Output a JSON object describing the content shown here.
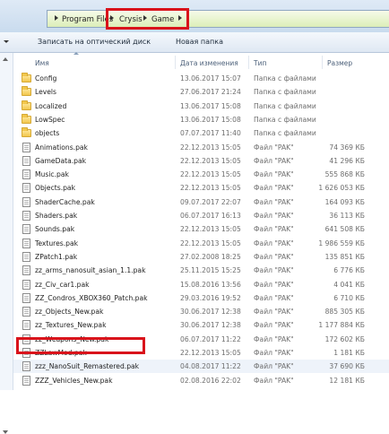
{
  "address": {
    "crumbs": [
      "Program Files",
      "Crysis",
      "Game"
    ]
  },
  "toolbar": {
    "burn_label": "Записать на оптический диск",
    "new_folder_label": "Новая папка"
  },
  "columns": {
    "name": "Имя",
    "date": "Дата изменения",
    "type": "Тип",
    "size": "Размер"
  },
  "files": [
    {
      "name": "Config",
      "date": "13.06.2017 15:07",
      "type": "Папка с файлами",
      "size": "",
      "icon": "folder-icon"
    },
    {
      "name": "Levels",
      "date": "27.06.2017 21:24",
      "type": "Папка с файлами",
      "size": "",
      "icon": "folder-icon"
    },
    {
      "name": "Localized",
      "date": "13.06.2017 15:08",
      "type": "Папка с файлами",
      "size": "",
      "icon": "folder-icon"
    },
    {
      "name": "LowSpec",
      "date": "13.06.2017 15:08",
      "type": "Папка с файлами",
      "size": "",
      "icon": "folder-icon"
    },
    {
      "name": "objects",
      "date": "07.07.2017 11:40",
      "type": "Папка с файлами",
      "size": "",
      "icon": "folder-icon"
    },
    {
      "name": "Animations.pak",
      "date": "22.12.2013 15:05",
      "type": "Файл \"PAK\"",
      "size": "74 369 КБ",
      "icon": "file-icon"
    },
    {
      "name": "GameData.pak",
      "date": "22.12.2013 15:05",
      "type": "Файл \"PAK\"",
      "size": "41 296 КБ",
      "icon": "file-icon"
    },
    {
      "name": "Music.pak",
      "date": "22.12.2013 15:05",
      "type": "Файл \"PAK\"",
      "size": "555 868 КБ",
      "icon": "file-icon"
    },
    {
      "name": "Objects.pak",
      "date": "22.12.2013 15:05",
      "type": "Файл \"PAK\"",
      "size": "1 626 053 КБ",
      "icon": "file-icon"
    },
    {
      "name": "ShaderCache.pak",
      "date": "09.07.2017 22:07",
      "type": "Файл \"PAK\"",
      "size": "164 093 КБ",
      "icon": "file-icon"
    },
    {
      "name": "Shaders.pak",
      "date": "06.07.2017 16:13",
      "type": "Файл \"PAK\"",
      "size": "36 113 КБ",
      "icon": "file-icon"
    },
    {
      "name": "Sounds.pak",
      "date": "22.12.2013 15:05",
      "type": "Файл \"PAK\"",
      "size": "641 508 КБ",
      "icon": "file-icon"
    },
    {
      "name": "Textures.pak",
      "date": "22.12.2013 15:05",
      "type": "Файл \"PAK\"",
      "size": "1 986 559 КБ",
      "icon": "file-icon"
    },
    {
      "name": "ZPatch1.pak",
      "date": "27.02.2008 18:25",
      "type": "Файл \"PAK\"",
      "size": "135 851 КБ",
      "icon": "file-icon"
    },
    {
      "name": "zz_arms_nanosuit_asian_1.1.pak",
      "date": "25.11.2015 15:25",
      "type": "Файл \"PAK\"",
      "size": "6 776 КБ",
      "icon": "file-icon"
    },
    {
      "name": "zz_Civ_car1.pak",
      "date": "15.08.2016 13:56",
      "type": "Файл \"PAK\"",
      "size": "4 041 КБ",
      "icon": "file-icon"
    },
    {
      "name": "ZZ_Condros_XBOX360_Patch.pak",
      "date": "29.03.2016 19:52",
      "type": "Файл \"PAK\"",
      "size": "6 710 КБ",
      "icon": "file-icon"
    },
    {
      "name": "zz_Objects_New.pak",
      "date": "30.06.2017 12:38",
      "type": "Файл \"PAK\"",
      "size": "885 305 КБ",
      "icon": "file-icon"
    },
    {
      "name": "zz_Textures_New.pak",
      "date": "30.06.2017 12:38",
      "type": "Файл \"PAK\"",
      "size": "1 177 884 КБ",
      "icon": "file-icon"
    },
    {
      "name": "zz_Weapons_New.pak",
      "date": "06.07.2017 11:22",
      "type": "Файл \"PAK\"",
      "size": "172 602 КБ",
      "icon": "file-icon"
    },
    {
      "name": "ZZLawMod.pak",
      "date": "22.12.2013 15:05",
      "type": "Файл \"PAK\"",
      "size": "1 181 КБ",
      "icon": "file-icon"
    },
    {
      "name": "zzz_NanoSuit_Remastered.pak",
      "date": "04.08.2017 11:22",
      "type": "Файл \"PAK\"",
      "size": "37 690 КБ",
      "icon": "file-icon"
    },
    {
      "name": "ZZZ_Vehicles_New.pak",
      "date": "02.08.2016 22:02",
      "type": "Файл \"PAK\"",
      "size": "12 181 КБ",
      "icon": "file-icon"
    }
  ],
  "colors": {
    "highlight": "#d9131b",
    "address_bar": "#dceeb8"
  }
}
